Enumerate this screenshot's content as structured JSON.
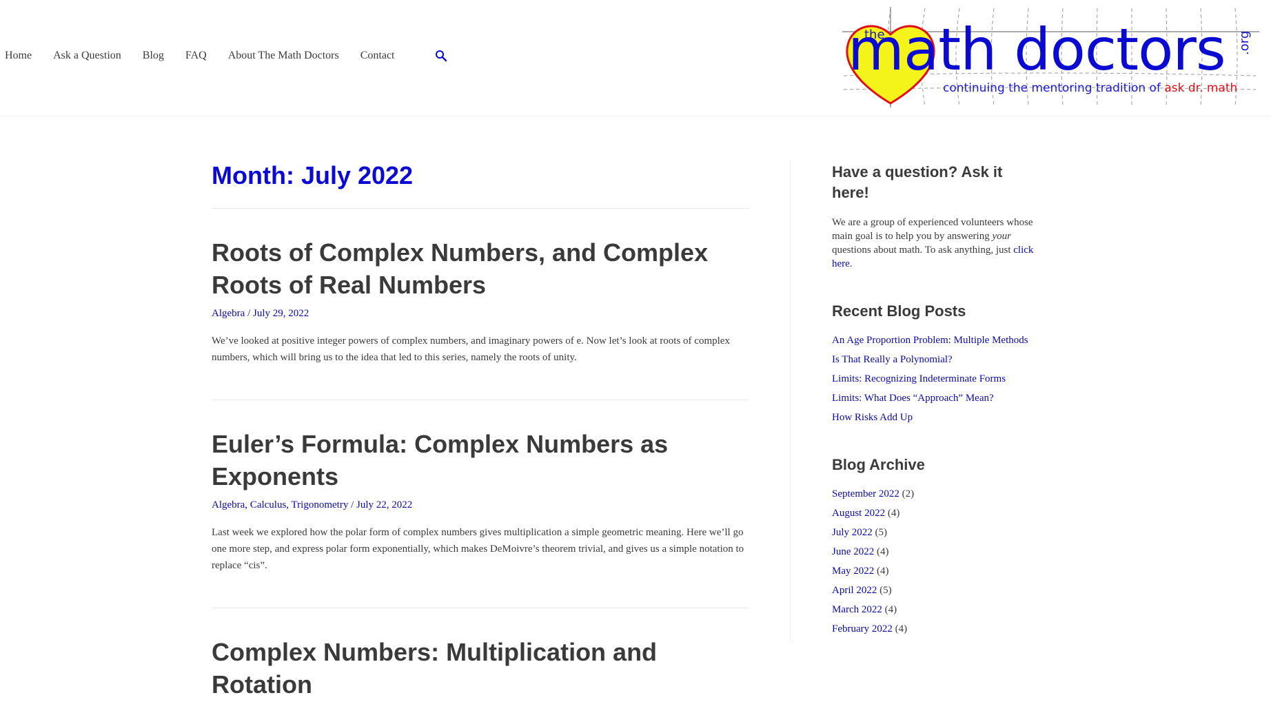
{
  "nav": {
    "items": [
      "Home",
      "Ask a Question",
      "Blog",
      "FAQ",
      "About The Math Doctors",
      "Contact"
    ],
    "search_icon": "search-icon"
  },
  "logo": {
    "the": "the",
    "main": "math doctors",
    "org": ".org",
    "tagline": "continuing the mentoring tradition of",
    "tagline_red": "ask dr. math"
  },
  "colors": {
    "accent": "#0a0ad0",
    "link": "#0a0aa0",
    "text": "#3a3a3a",
    "logo_red": "#e0101a",
    "logo_yellow": "#f4f41a"
  },
  "page": {
    "title": "Month: July 2022"
  },
  "posts": [
    {
      "title": "Roots of Complex Numbers, and Complex Roots of Real Numbers",
      "categories": "Algebra",
      "date": "July 29, 2022",
      "excerpt": "We’ve looked at positive integer powers of complex numbers, and imaginary powers of e. Now let’s look at roots of complex numbers, which will bring us to the idea that led to this series, namely the roots of unity."
    },
    {
      "title": "Euler’s Formula: Complex Numbers as Exponents",
      "categories": "Algebra, Calculus, Trigonometry",
      "date": "July 22, 2022",
      "excerpt": "Last week we explored how the polar form of complex numbers gives multiplication a simple geometric meaning. Here we’ll go one more step, and express polar form exponentially, which makes DeMoivre’s theorem trivial, and gives us a simple notation to replace “cis”."
    },
    {
      "title": "Complex Numbers: Multiplication and Rotation"
    }
  ],
  "sidebar": {
    "ask": {
      "heading": "Have a question? Ask it here!",
      "text1": "We are a group of experienced volunteers whose main goal is to help you by answering ",
      "text_em": "your",
      "text2": " questions about math. To ask anything, just ",
      "link": "click here",
      "text3": "."
    },
    "recent": {
      "heading": "Recent Blog Posts",
      "items": [
        "An Age Proportion Problem: Multiple Methods",
        "Is That Really a Polynomial?",
        "Limits: Recognizing Indeterminate Forms",
        "Limits: What Does “Approach” Mean?",
        "How Risks Add Up"
      ]
    },
    "archive": {
      "heading": "Blog Archive",
      "items": [
        {
          "month": "September 2022",
          "count": "(2)"
        },
        {
          "month": "August 2022",
          "count": "(4)"
        },
        {
          "month": "July 2022",
          "count": "(5)"
        },
        {
          "month": "June 2022",
          "count": "(4)"
        },
        {
          "month": "May 2022",
          "count": "(4)"
        },
        {
          "month": "April 2022",
          "count": "(5)"
        },
        {
          "month": "March 2022",
          "count": "(4)"
        },
        {
          "month": "February 2022",
          "count": "(4)"
        }
      ]
    }
  }
}
